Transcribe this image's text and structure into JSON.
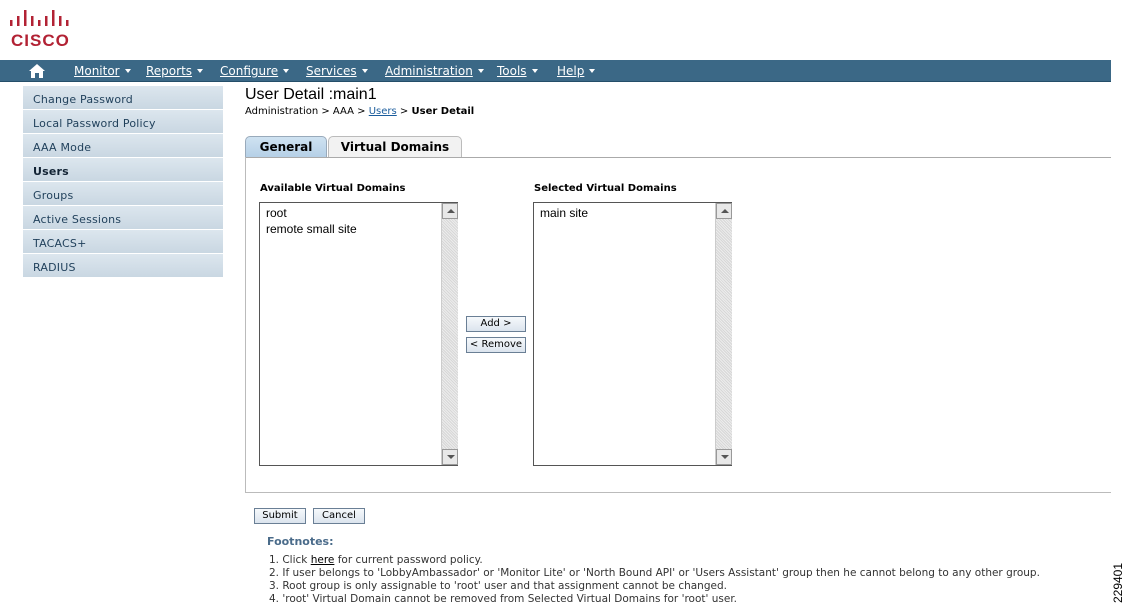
{
  "logo": {
    "text": "CISCO",
    "icon": "cisco-logo"
  },
  "nav": {
    "home_icon": "home-icon",
    "items": [
      {
        "label": "Monitor"
      },
      {
        "label": "Reports"
      },
      {
        "label": "Configure"
      },
      {
        "label": "Services"
      },
      {
        "label": "Administration"
      },
      {
        "label": "Tools"
      },
      {
        "label": "Help"
      }
    ]
  },
  "sidebar": {
    "items": [
      {
        "label": "Change Password"
      },
      {
        "label": "Local Password Policy"
      },
      {
        "label": "AAA Mode"
      },
      {
        "label": "Users",
        "active": true
      },
      {
        "label": "Groups"
      },
      {
        "label": "Active Sessions"
      },
      {
        "label": "TACACS+"
      },
      {
        "label": "RADIUS"
      }
    ]
  },
  "header": {
    "title": "User Detail :main1",
    "breadcrumb": {
      "part1": "Administration > AAA > ",
      "link": " Users",
      "sep": " > ",
      "current": "User Detail"
    }
  },
  "tabs": [
    {
      "label": "General"
    },
    {
      "label": "Virtual Domains",
      "selected": true
    }
  ],
  "domains": {
    "available_label": "Available Virtual Domains",
    "selected_label": "Selected Virtual Domains",
    "available": [
      "root",
      "remote small site"
    ],
    "selected": [
      "main site"
    ],
    "add_label": "Add >",
    "remove_label": "< Remove"
  },
  "actions": {
    "submit_label": "Submit",
    "cancel_label": "Cancel"
  },
  "footnotes": {
    "title": "Footnotes:",
    "line1_prefix": "1. Click ",
    "line1_link": "here",
    "line1_suffix": " for current password policy.",
    "line2": "2. If user belongs to 'LobbyAmbassador' or 'Monitor Lite' or 'North Bound API' or 'Users Assistant' group then he cannot belong to any other group.",
    "line3": "3. Root group is only assignable to 'root' user and that assignment cannot be changed.",
    "line4": "4. 'root' Virtual Domain cannot be removed from Selected Virtual Domains for 'root' user."
  },
  "figure_id": "229401"
}
